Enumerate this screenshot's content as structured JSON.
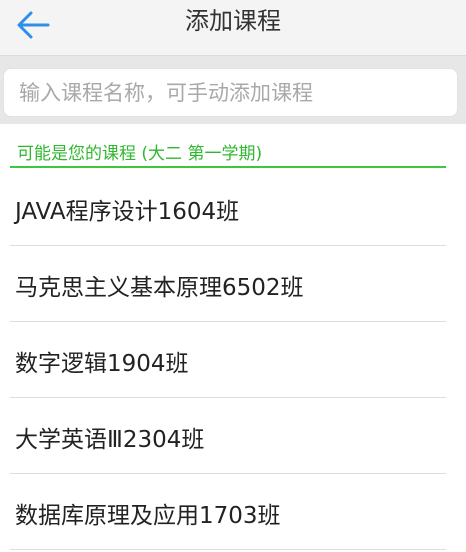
{
  "header": {
    "title": "添加课程",
    "back_icon": "arrow-left-icon",
    "accent_color": "#2f8ee8"
  },
  "search": {
    "placeholder": "输入课程名称，可手动添加课程",
    "value": ""
  },
  "suggestions": {
    "title": "可能是您的课程 (大二 第一学期)",
    "accent_color": "#2fb82f",
    "items": [
      {
        "label": "JAVA程序设计1604班"
      },
      {
        "label": "马克思主义基本原理6502班"
      },
      {
        "label": "数字逻辑1904班"
      },
      {
        "label": "大学英语Ⅲ2304班"
      },
      {
        "label": "数据库原理及应用1703班"
      }
    ]
  }
}
